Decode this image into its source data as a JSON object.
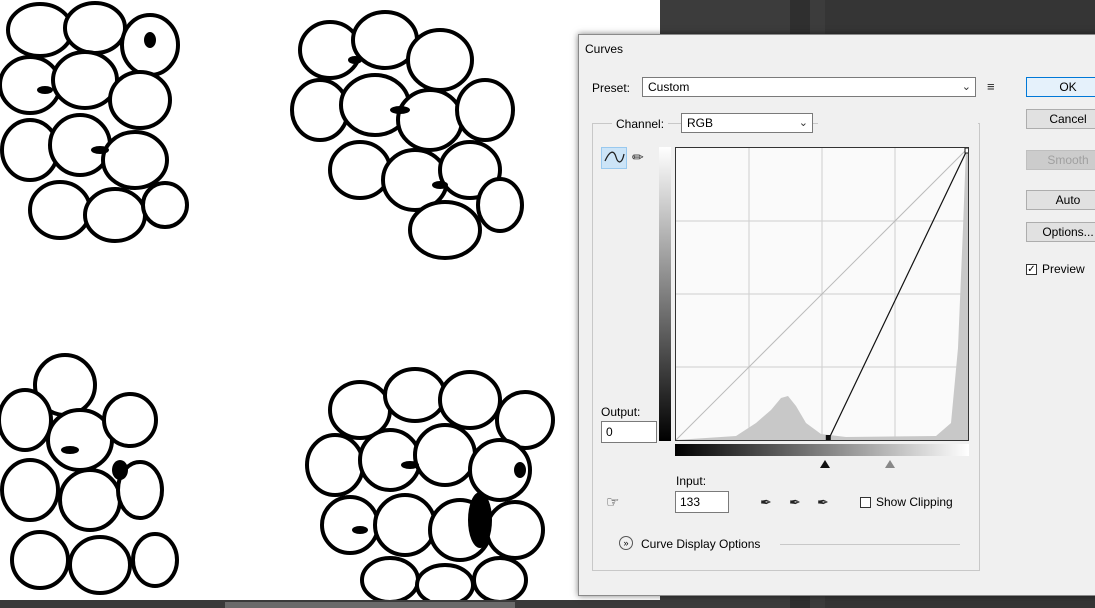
{
  "dialog": {
    "title": "Curves",
    "preset_label": "Preset:",
    "preset_value": "Custom",
    "channel_label": "Channel:",
    "channel_value": "RGB",
    "output_label": "Output:",
    "output_value": "0",
    "input_label": "Input:",
    "input_value": "133",
    "show_clipping_label": "Show Clipping",
    "curve_display_options_label": "Curve Display Options",
    "buttons": {
      "ok": "OK",
      "cancel": "Cancel",
      "smooth": "Smooth",
      "auto": "Auto",
      "options": "Options..."
    },
    "preview_label": "Preview",
    "preview_checked": true,
    "show_clipping_checked": false
  },
  "curve": {
    "points": [
      [
        133,
        0
      ],
      [
        255,
        255
      ]
    ],
    "range": [
      0,
      255
    ]
  },
  "icons": {
    "preset_menu": "preset-options-icon",
    "curve_tool": "curve-points-icon",
    "pencil_tool": "pencil-icon",
    "hand_tool": "on-image-adjust-icon",
    "eyedroppers": [
      "black-point-eyedropper-icon",
      "gray-point-eyedropper-icon",
      "white-point-eyedropper-icon"
    ],
    "expand": "expand-chevron-icon"
  }
}
